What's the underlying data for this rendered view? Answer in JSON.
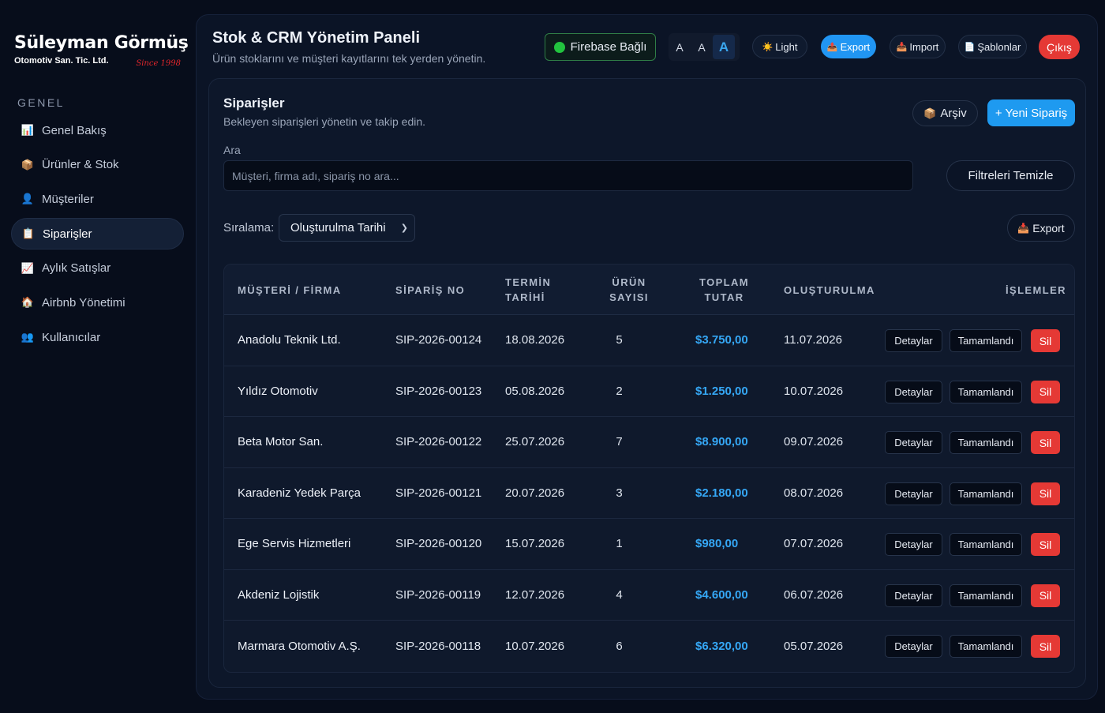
{
  "brand": {
    "name": "Süleyman Görmüş",
    "subtitle": "Otomotiv San. Tic. Ltd.",
    "since": "Since 1998"
  },
  "sidebar": {
    "section": "GENEL",
    "items": [
      {
        "label": "Genel Bakış",
        "icon": "bar-chart-icon",
        "glyph": "📊"
      },
      {
        "label": "Ürünler & Stok",
        "icon": "package-icon",
        "glyph": "📦"
      },
      {
        "label": "Müşteriler",
        "icon": "user-icon",
        "glyph": "👤"
      },
      {
        "label": "Siparişler",
        "icon": "clipboard-icon",
        "glyph": "📋",
        "active": true
      },
      {
        "label": "Aylık Satışlar",
        "icon": "trend-chart-icon",
        "glyph": "📈"
      },
      {
        "label": "Airbnb Yönetimi",
        "icon": "house-icon",
        "glyph": "🏠"
      },
      {
        "label": "Kullanıcılar",
        "icon": "users-icon",
        "glyph": "👥"
      }
    ]
  },
  "header": {
    "title": "Stok & CRM Yönetim Paneli",
    "subtitle": "Ürün stoklarını ve müşteri kayıtlarını tek yerden yönetin.",
    "firebase_status": "Firebase Bağlı",
    "font_sizes": [
      "A",
      "A",
      "A"
    ],
    "light_label": "Light",
    "export_label": "Export",
    "import_label": "Import",
    "templates_label": "Şablonlar",
    "logout_label": "Çıkış",
    "colors": {
      "accent": "#2196f3",
      "danger": "#e53935",
      "success": "#22c33f"
    }
  },
  "orders": {
    "title": "Siparişler",
    "subtitle": "Bekleyen siparişleri yönetin ve takip edin.",
    "archive_label": "Arşiv",
    "new_label": "+ Yeni Sipariş",
    "search_label": "Ara",
    "search_placeholder": "Müşteri, firma adı, sipariş no ara...",
    "clear_filters_label": "Filtreleri Temizle",
    "sort_label": "Sıralama:",
    "sort_value": "Oluşturulma Tarihi",
    "export_label": "Export",
    "columns": {
      "customer": "MÜŞTERİ / FİRMA",
      "order_no": "SİPARİŞ NO",
      "due_date": "TERMİN TARİHİ",
      "item_count": "ÜRÜN SAYISI",
      "total": "TOPLAM TUTAR",
      "created": "OLUŞTURULMA",
      "actions": "İŞLEMLER"
    },
    "action_labels": {
      "details": "Detaylar",
      "complete": "Tamamlandı",
      "delete": "Sil"
    },
    "rows": [
      {
        "customer": "Anadolu Teknik Ltd.",
        "order_no": "SIP-2026-00124",
        "due_date": "18.08.2026",
        "item_count": "5",
        "total": "$3.750,00",
        "created": "11.07.2026"
      },
      {
        "customer": "Yıldız Otomotiv",
        "order_no": "SIP-2026-00123",
        "due_date": "05.08.2026",
        "item_count": "2",
        "total": "$1.250,00",
        "created": "10.07.2026"
      },
      {
        "customer": "Beta Motor San.",
        "order_no": "SIP-2026-00122",
        "due_date": "25.07.2026",
        "item_count": "7",
        "total": "$8.900,00",
        "created": "09.07.2026"
      },
      {
        "customer": "Karadeniz Yedek Parça",
        "order_no": "SIP-2026-00121",
        "due_date": "20.07.2026",
        "item_count": "3",
        "total": "$2.180,00",
        "created": "08.07.2026"
      },
      {
        "customer": "Ege Servis Hizmetleri",
        "order_no": "SIP-2026-00120",
        "due_date": "15.07.2026",
        "item_count": "1",
        "total": "$980,00",
        "created": "07.07.2026"
      },
      {
        "customer": "Akdeniz Lojistik",
        "order_no": "SIP-2026-00119",
        "due_date": "12.07.2026",
        "item_count": "4",
        "total": "$4.600,00",
        "created": "06.07.2026"
      },
      {
        "customer": "Marmara Otomotiv A.Ş.",
        "order_no": "SIP-2026-00118",
        "due_date": "10.07.2026",
        "item_count": "6",
        "total": "$6.320,00",
        "created": "05.07.2026"
      }
    ]
  }
}
